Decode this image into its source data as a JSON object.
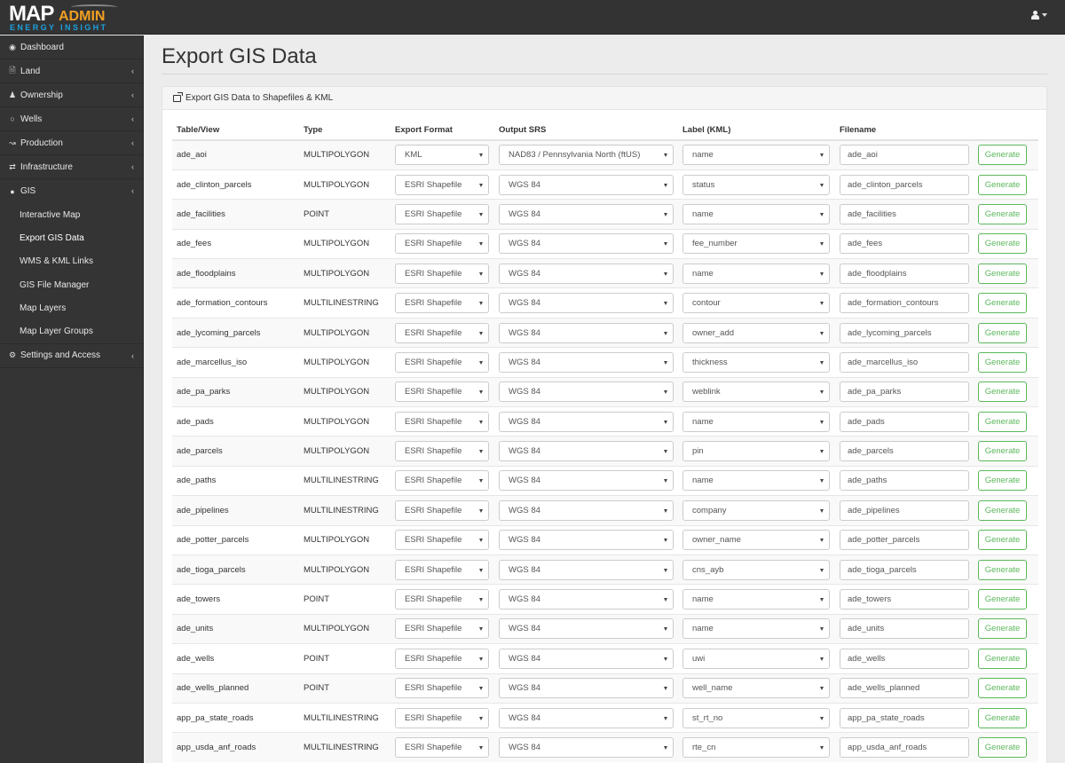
{
  "app": {
    "logo_main": "MAP",
    "logo_accent": "ADMIN",
    "logo_tagline": "ENERGY INSIGHT",
    "brand_colors": {
      "logo_accent": "#f0a022",
      "tagline": "#1ea0e0",
      "topbar": "#333333",
      "sidebar": "#343434",
      "generate_button": "#5cb85c"
    }
  },
  "topbar": {
    "user_icon": "user-icon",
    "user_dropdown_icon": "caret-down-icon"
  },
  "sidebar": {
    "items": [
      {
        "label": "Dashboard",
        "icon": "dashboard-icon",
        "has_chevron": false
      },
      {
        "label": "Land",
        "icon": "file-icon",
        "has_chevron": true
      },
      {
        "label": "Ownership",
        "icon": "user-icon",
        "has_chevron": true
      },
      {
        "label": "Wells",
        "icon": "circle-icon",
        "has_chevron": true
      },
      {
        "label": "Production",
        "icon": "line-chart-icon",
        "has_chevron": true
      },
      {
        "label": "Infrastructure",
        "icon": "exchange-icon",
        "has_chevron": true
      },
      {
        "label": "GIS",
        "icon": "globe-icon",
        "has_chevron": true
      },
      {
        "label": "Settings and Access",
        "icon": "cogs-icon",
        "has_chevron": true
      }
    ],
    "gis_subitems": [
      {
        "label": "Interactive Map",
        "active": false
      },
      {
        "label": "Export GIS Data",
        "active": true
      },
      {
        "label": "WMS & KML Links",
        "active": false
      },
      {
        "label": "GIS File Manager",
        "active": false
      },
      {
        "label": "Map Layers",
        "active": false
      },
      {
        "label": "Map Layer Groups",
        "active": false
      }
    ]
  },
  "page": {
    "title": "Export GIS Data",
    "panel_heading": "Export GIS Data to Shapefiles & KML"
  },
  "table": {
    "headers": [
      "Table/View",
      "Type",
      "Export Format",
      "Output SRS",
      "Label (KML)",
      "Filename",
      ""
    ],
    "button_label": "Generate",
    "rows": [
      {
        "table": "ade_aoi",
        "type": "MULTIPOLYGON",
        "format": "KML",
        "srs": "NAD83 / Pennsylvania North (ftUS)",
        "label": "name",
        "filename": "ade_aoi"
      },
      {
        "table": "ade_clinton_parcels",
        "type": "MULTIPOLYGON",
        "format": "ESRI Shapefile",
        "srs": "WGS 84",
        "label": "status",
        "filename": "ade_clinton_parcels"
      },
      {
        "table": "ade_facilities",
        "type": "POINT",
        "format": "ESRI Shapefile",
        "srs": "WGS 84",
        "label": "name",
        "filename": "ade_facilities"
      },
      {
        "table": "ade_fees",
        "type": "MULTIPOLYGON",
        "format": "ESRI Shapefile",
        "srs": "WGS 84",
        "label": "fee_number",
        "filename": "ade_fees"
      },
      {
        "table": "ade_floodplains",
        "type": "MULTIPOLYGON",
        "format": "ESRI Shapefile",
        "srs": "WGS 84",
        "label": "name",
        "filename": "ade_floodplains"
      },
      {
        "table": "ade_formation_contours",
        "type": "MULTILINESTRING",
        "format": "ESRI Shapefile",
        "srs": "WGS 84",
        "label": "contour",
        "filename": "ade_formation_contours"
      },
      {
        "table": "ade_lycoming_parcels",
        "type": "MULTIPOLYGON",
        "format": "ESRI Shapefile",
        "srs": "WGS 84",
        "label": "owner_add",
        "filename": "ade_lycoming_parcels"
      },
      {
        "table": "ade_marcellus_iso",
        "type": "MULTIPOLYGON",
        "format": "ESRI Shapefile",
        "srs": "WGS 84",
        "label": "thickness",
        "filename": "ade_marcellus_iso"
      },
      {
        "table": "ade_pa_parks",
        "type": "MULTIPOLYGON",
        "format": "ESRI Shapefile",
        "srs": "WGS 84",
        "label": "weblink",
        "filename": "ade_pa_parks"
      },
      {
        "table": "ade_pads",
        "type": "MULTIPOLYGON",
        "format": "ESRI Shapefile",
        "srs": "WGS 84",
        "label": "name",
        "filename": "ade_pads"
      },
      {
        "table": "ade_parcels",
        "type": "MULTIPOLYGON",
        "format": "ESRI Shapefile",
        "srs": "WGS 84",
        "label": "pin",
        "filename": "ade_parcels"
      },
      {
        "table": "ade_paths",
        "type": "MULTILINESTRING",
        "format": "ESRI Shapefile",
        "srs": "WGS 84",
        "label": "name",
        "filename": "ade_paths"
      },
      {
        "table": "ade_pipelines",
        "type": "MULTILINESTRING",
        "format": "ESRI Shapefile",
        "srs": "WGS 84",
        "label": "company",
        "filename": "ade_pipelines"
      },
      {
        "table": "ade_potter_parcels",
        "type": "MULTIPOLYGON",
        "format": "ESRI Shapefile",
        "srs": "WGS 84",
        "label": "owner_name",
        "filename": "ade_potter_parcels"
      },
      {
        "table": "ade_tioga_parcels",
        "type": "MULTIPOLYGON",
        "format": "ESRI Shapefile",
        "srs": "WGS 84",
        "label": "cns_ayb",
        "filename": "ade_tioga_parcels"
      },
      {
        "table": "ade_towers",
        "type": "POINT",
        "format": "ESRI Shapefile",
        "srs": "WGS 84",
        "label": "name",
        "filename": "ade_towers"
      },
      {
        "table": "ade_units",
        "type": "MULTIPOLYGON",
        "format": "ESRI Shapefile",
        "srs": "WGS 84",
        "label": "name",
        "filename": "ade_units"
      },
      {
        "table": "ade_wells",
        "type": "POINT",
        "format": "ESRI Shapefile",
        "srs": "WGS 84",
        "label": "uwi",
        "filename": "ade_wells"
      },
      {
        "table": "ade_wells_planned",
        "type": "POINT",
        "format": "ESRI Shapefile",
        "srs": "WGS 84",
        "label": "well_name",
        "filename": "ade_wells_planned"
      },
      {
        "table": "app_pa_state_roads",
        "type": "MULTILINESTRING",
        "format": "ESRI Shapefile",
        "srs": "WGS 84",
        "label": "st_rt_no",
        "filename": "app_pa_state_roads"
      },
      {
        "table": "app_usda_anf_roads",
        "type": "MULTILINESTRING",
        "format": "ESRI Shapefile",
        "srs": "WGS 84",
        "label": "rte_cn",
        "filename": "app_usda_anf_roads"
      }
    ]
  }
}
